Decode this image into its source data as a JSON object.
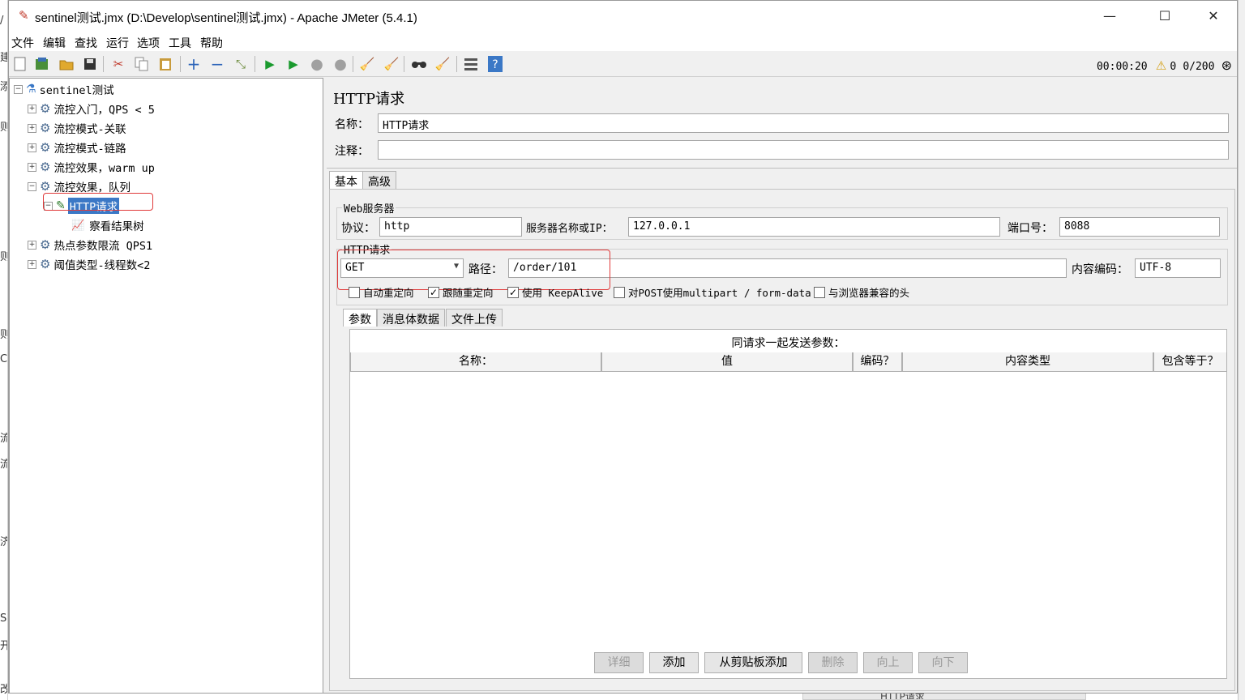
{
  "window": {
    "title": "sentinel测试.jmx (D:\\Develop\\sentinel测试.jmx) - Apache JMeter (5.4.1)",
    "minimize": "—",
    "maximize": "☐",
    "close": "✕"
  },
  "menu": [
    "文件",
    "编辑",
    "查找",
    "运行",
    "选项",
    "工具",
    "帮助"
  ],
  "status": {
    "timer": "00:00:20",
    "warnings": "0",
    "threads": "0/200"
  },
  "tree": {
    "root": "sentinel测试",
    "items": [
      "流控入门，QPS < 5",
      "流控模式-关联",
      "流控模式-链路",
      "流控效果，warm up",
      "流控效果，队列"
    ],
    "selected": "HTTP请求",
    "child": "察看结果树",
    "after": [
      "热点参数限流 QPS1",
      "阈值类型-线程数<2"
    ]
  },
  "panel": {
    "heading": "HTTP请求",
    "name_label": "名称：",
    "name_value": "HTTP请求",
    "comment_label": "注释：",
    "comment_value": "",
    "tabs": [
      "基本",
      "高级"
    ],
    "web_server": {
      "title": "Web服务器",
      "protocol_label": "协议：",
      "protocol": "http",
      "server_label": "服务器名称或IP：",
      "server": "127.0.0.1",
      "port_label": "端口号：",
      "port": "8088"
    },
    "http_request": {
      "title": "HTTP请求",
      "method": "GET",
      "path_label": "路径：",
      "path": "/order/101",
      "encoding_label": "内容编码：",
      "encoding": "UTF-8"
    },
    "checkboxes": [
      {
        "label": "自动重定向",
        "checked": false
      },
      {
        "label": "跟随重定向",
        "checked": true
      },
      {
        "label": "使用 KeepAlive",
        "checked": true
      },
      {
        "label": "对POST使用multipart / form-data",
        "checked": false
      },
      {
        "label": "与浏览器兼容的头",
        "checked": false
      }
    ],
    "subtabs": [
      "参数",
      "消息体数据",
      "文件上传"
    ],
    "table_caption": "同请求一起发送参数：",
    "columns": [
      "名称：",
      "值",
      "编码？",
      "内容类型",
      "包含等于？"
    ],
    "buttons": [
      "详细",
      "添加",
      "从剪贴板添加",
      "删除",
      "向上",
      "向下"
    ]
  },
  "background": {
    "left_chars": [
      "/",
      "建",
      "添",
      "则",
      "则",
      "则",
      "C",
      "流",
      "流",
      "济",
      "Se",
      "开",
      "改"
    ],
    "bottom_text": "HTTP请求"
  }
}
